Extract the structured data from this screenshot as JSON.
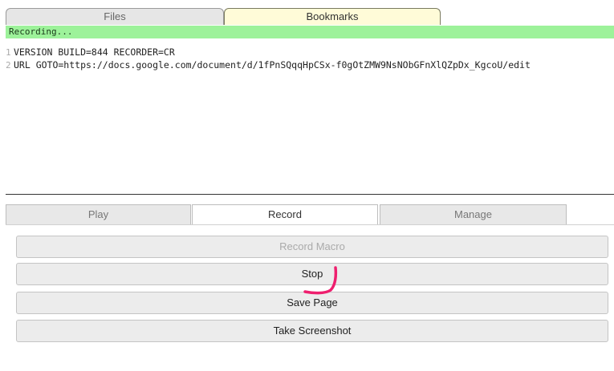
{
  "top_tabs": {
    "files": "Files",
    "bookmarks": "Bookmarks"
  },
  "status": {
    "text": "Recording..."
  },
  "editor": {
    "lines": [
      {
        "num": "1",
        "text": "VERSION BUILD=844 RECORDER=CR"
      },
      {
        "num": "2",
        "text": "URL GOTO=https://docs.google.com/document/d/1fPnSQqqHpCSx-f0gOtZMW9NsNObGFnXlQZpDx_KgcoU/edit"
      }
    ]
  },
  "bottom_tabs": {
    "play": "Play",
    "record": "Record",
    "manage": "Manage"
  },
  "actions": {
    "record_macro": "Record Macro",
    "stop": "Stop",
    "save_page": "Save Page",
    "take_screenshot": "Take Screenshot"
  },
  "colors": {
    "status_bg": "#9df29a",
    "bookmarks_tab_bg": "#fffbd8",
    "annotation_stroke": "#ee1f6e"
  }
}
